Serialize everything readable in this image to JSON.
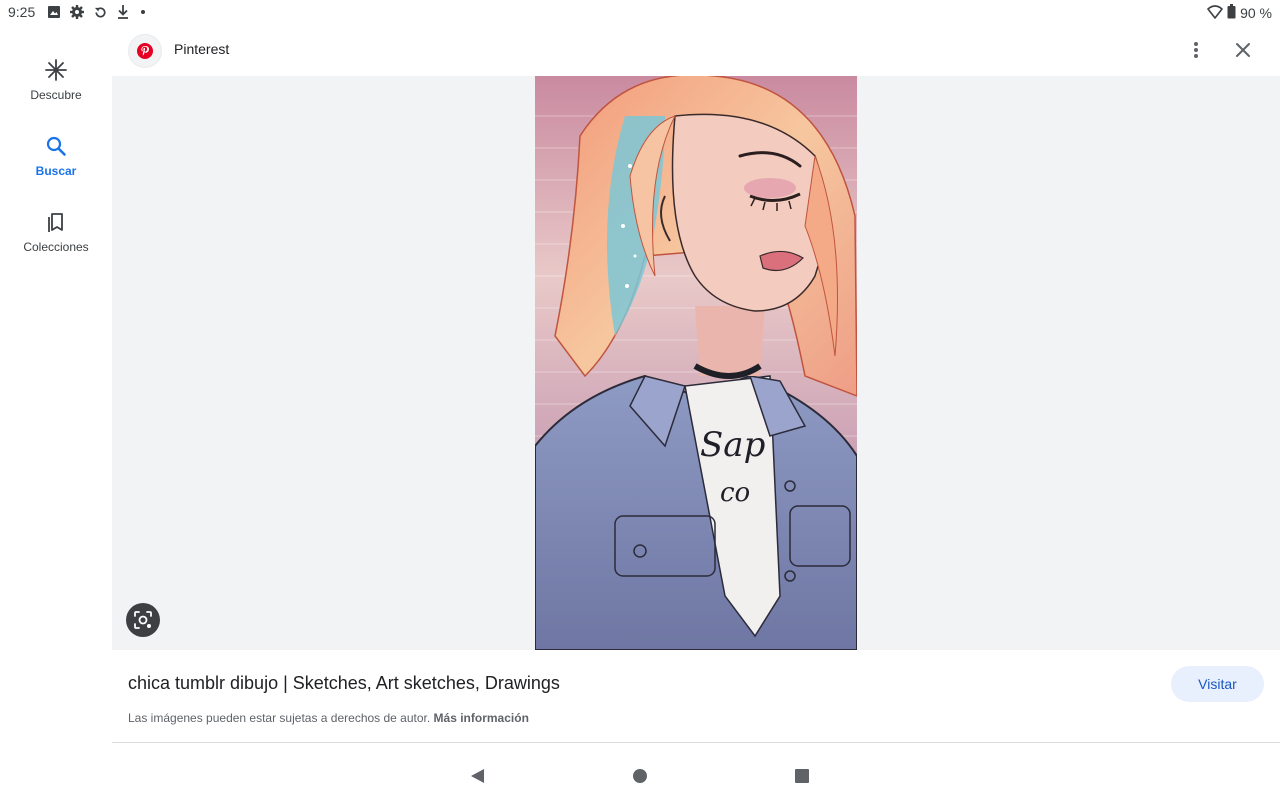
{
  "status_bar": {
    "time": "9:25",
    "left_icons": [
      "image-icon",
      "gear-icon",
      "sync-icon",
      "download-icon",
      "dot-icon"
    ],
    "battery_text": "90 %",
    "right_icons": [
      "wifi-icon",
      "battery-icon"
    ]
  },
  "nav": {
    "items": [
      {
        "label": "Descubre",
        "icon": "asterisk-icon",
        "active": false
      },
      {
        "label": "Buscar",
        "icon": "search-icon",
        "active": true
      },
      {
        "label": "Colecciones",
        "icon": "collections-icon",
        "active": false
      }
    ]
  },
  "header": {
    "source_name": "Pinterest",
    "favicon": "pinterest-logo",
    "menu_icon": "more-vert-icon",
    "close_icon": "close-icon"
  },
  "preview": {
    "lens_icon": "lens-icon"
  },
  "info": {
    "title": "chica tumblr dibujo | Sketches, Art sketches, Drawings",
    "visit_label": "Visitar",
    "copyright_text": "Las imágenes pueden estar sujetas a derechos de autor.",
    "more_info_label": "Más información"
  },
  "system_nav": {
    "back_icon": "back-triangle-icon",
    "home_icon": "home-circle-icon",
    "recents_icon": "recents-square-icon"
  },
  "colors": {
    "accent": "#1a73e8",
    "visit_bg": "#e8f0fe",
    "preview_bg": "#f1f3f4",
    "pinterest_red": "#e60023"
  }
}
